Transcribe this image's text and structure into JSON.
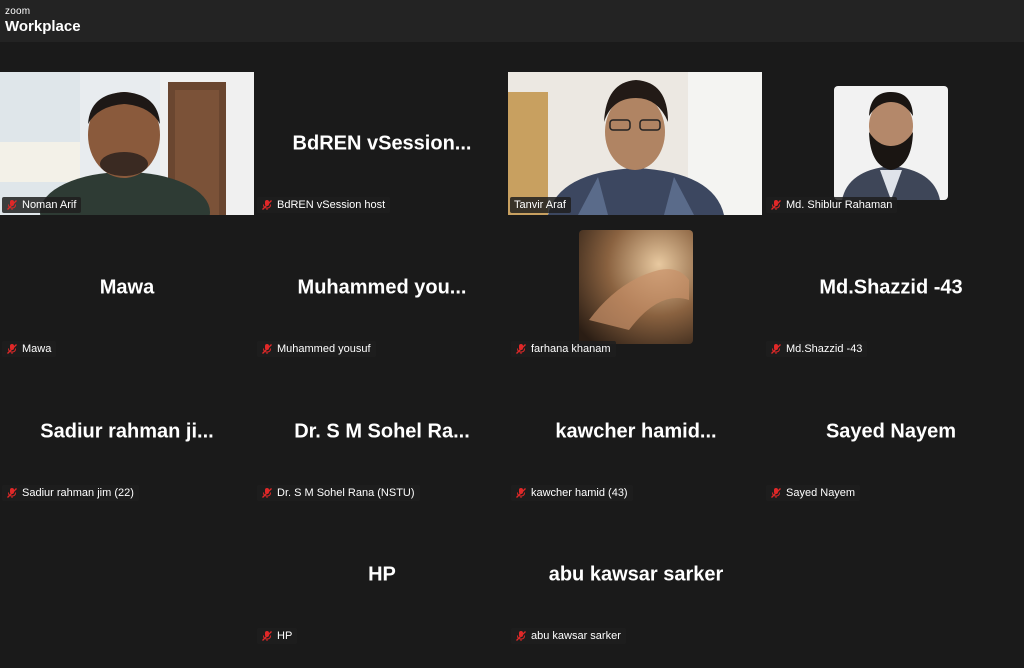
{
  "app": {
    "brand_small": "zoom",
    "brand_big": "Workplace"
  },
  "participants": [
    {
      "display": "",
      "tag": "Noman Arif",
      "type": "video"
    },
    {
      "display": "BdREN  vSession...",
      "tag": "BdREN vSession host",
      "type": "name"
    },
    {
      "display": "",
      "tag": "Tanvir Araf",
      "type": "video",
      "speaking": true
    },
    {
      "display": "",
      "tag": "Md. Shiblur Rahaman",
      "type": "avatar"
    },
    {
      "display": "Mawa",
      "tag": "Mawa",
      "type": "name"
    },
    {
      "display": "Muhammed  you...",
      "tag": "Muhammed yousuf",
      "type": "name"
    },
    {
      "display": "",
      "tag": "farhana khanam",
      "type": "avatar"
    },
    {
      "display": "Md.Shazzid -43",
      "tag": "Md.Shazzid -43",
      "type": "name"
    },
    {
      "display": "Sadiur rahman ji...",
      "tag": "Sadiur rahman jim (22)",
      "type": "name"
    },
    {
      "display": "Dr. S M Sohel Ra...",
      "tag": "Dr. S M Sohel Rana (NSTU)",
      "type": "name"
    },
    {
      "display": "kawcher  hamid...",
      "tag": "kawcher hamid (43)",
      "type": "name"
    },
    {
      "display": "Sayed Nayem",
      "tag": "Sayed Nayem",
      "type": "name"
    },
    {
      "display": "HP",
      "tag": "HP",
      "type": "name"
    },
    {
      "display": "abu kawsar sarker",
      "tag": "abu kawsar sarker",
      "type": "name"
    }
  ],
  "colors": {
    "speaking_border": "#23d959",
    "muted_icon": "#e02828",
    "background": "#1a1a1a"
  }
}
